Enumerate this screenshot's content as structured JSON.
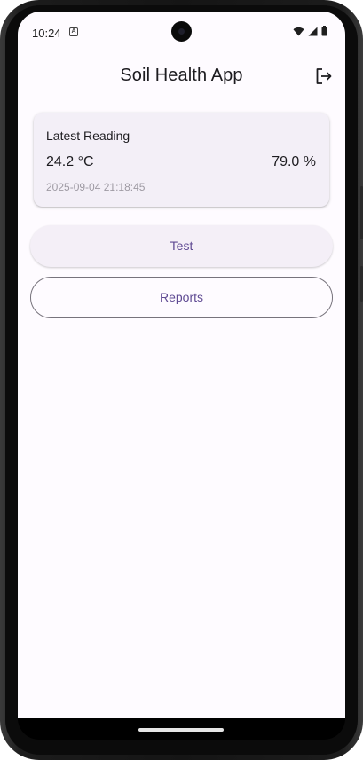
{
  "status_bar": {
    "time": "10:24",
    "notification_icon": "a-badge-icon",
    "icons": [
      "wifi-icon",
      "signal-icon",
      "battery-icon"
    ]
  },
  "app_bar": {
    "title": "Soil Health App",
    "action_icon": "logout-icon"
  },
  "latest_reading": {
    "title": "Latest Reading",
    "temperature": "24.2 °C",
    "humidity": "79.0 %",
    "timestamp": "2025-09-04 21:18:45"
  },
  "actions": {
    "test_label": "Test",
    "reports_label": "Reports"
  },
  "colors": {
    "background": "#fefbff",
    "card": "#f3eff7",
    "accent": "#5f4a93",
    "outline": "#77737c"
  }
}
